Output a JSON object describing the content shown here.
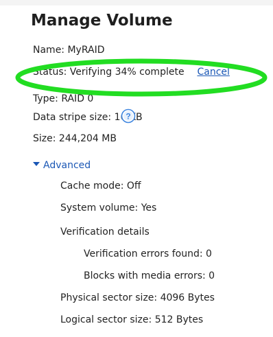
{
  "page": {
    "title": "Manage Volume"
  },
  "volume": {
    "name": "Name: MyRAID",
    "status": "Status: Verifying 34% complete",
    "cancel_label": "Cancel",
    "type": "Type: RAID 0",
    "stripe_size": "Data stripe size: 16 KB",
    "size": "Size: 244,204 MB",
    "verification_progress_percent": 34
  },
  "advanced": {
    "label": "Advanced",
    "expanded": true,
    "cache_mode": "Cache mode: Off",
    "system_volume": "System volume: Yes",
    "verification_details": "Verification details",
    "verification_errors": "Verification errors found: 0",
    "media_errors": "Blocks with media errors: 0",
    "physical_sector": "Physical sector size: 4096 Bytes",
    "logical_sector": "Logical sector size: 512 Bytes"
  },
  "colors": {
    "highlight": "#22dd22",
    "link": "#1a57b5",
    "help_icon": "#3f86e0"
  },
  "icons": {
    "help": "question-mark-icon",
    "expand": "triangle-down-icon"
  }
}
